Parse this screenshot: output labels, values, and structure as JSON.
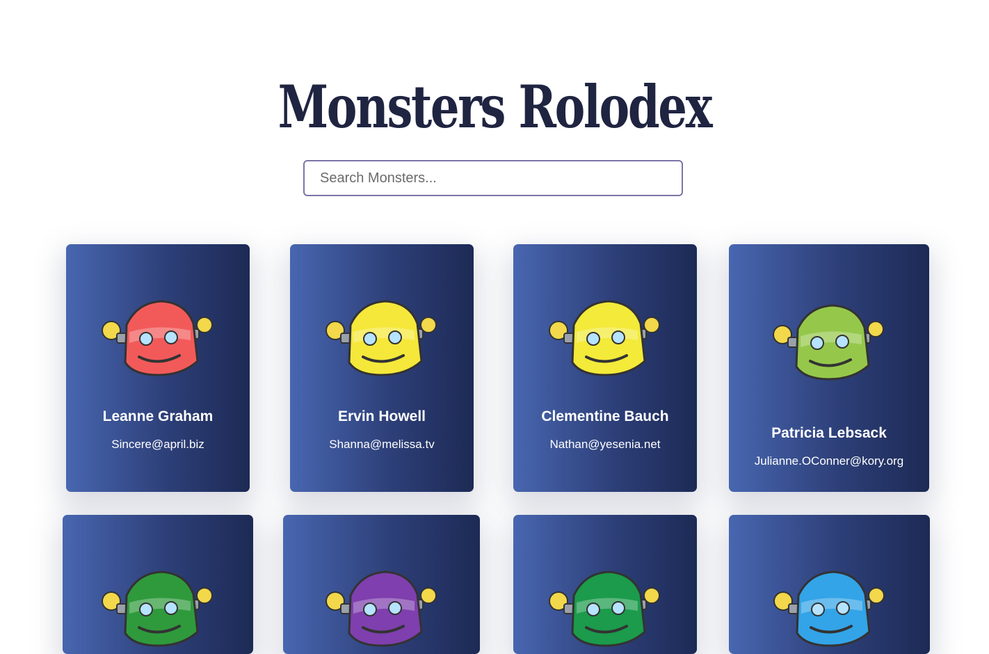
{
  "app": {
    "title": "Monsters Rolodex",
    "search": {
      "placeholder": "Search Monsters...",
      "value": ""
    }
  },
  "monsters": [
    {
      "name": "Leanne Graham",
      "email": "Sincere@april.biz",
      "color": "#f25a5a"
    },
    {
      "name": "Ervin Howell",
      "email": "Shanna@melissa.tv",
      "color": "#f5e83a"
    },
    {
      "name": "Clementine Bauch",
      "email": "Nathan@yesenia.net",
      "color": "#f3ea3a"
    },
    {
      "name": "Patricia Lebsack",
      "email": "Julianne.OConner@kory.org",
      "color": "#95c84a"
    },
    {
      "name": "",
      "email": "",
      "color": "#2f9a3c"
    },
    {
      "name": "",
      "email": "",
      "color": "#7f3fae"
    },
    {
      "name": "",
      "email": "",
      "color": "#1b9b4b"
    },
    {
      "name": "",
      "email": "",
      "color": "#33a4e8"
    }
  ]
}
